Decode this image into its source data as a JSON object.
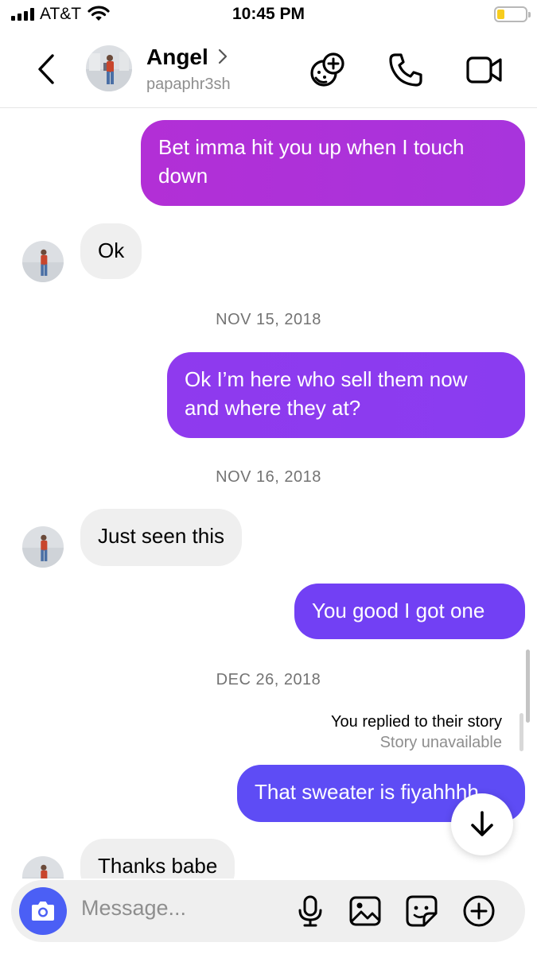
{
  "status": {
    "carrier": "AT&T",
    "time": "10:45 PM",
    "battery_color": "#f7cc1d"
  },
  "header": {
    "name": "Angel",
    "username": "papaphr3sh",
    "icons": [
      "back-icon",
      "chevron-right-icon",
      "add-effects-icon",
      "phone-icon",
      "video-icon"
    ]
  },
  "messages": [
    {
      "type": "out",
      "text": "Bet imma hit you up when I touch down"
    },
    {
      "type": "in",
      "text": "Ok"
    },
    {
      "type": "date",
      "text": "NOV 15, 2018"
    },
    {
      "type": "out",
      "text": "Ok I’m here who sell them now and where they at?"
    },
    {
      "type": "date",
      "text": "NOV 16, 2018"
    },
    {
      "type": "in",
      "text": "Just seen this"
    },
    {
      "type": "out",
      "text": "You good I got one"
    },
    {
      "type": "date",
      "text": "DEC 26, 2018"
    },
    {
      "type": "reply_note",
      "text": "You replied to their story",
      "sub": "Story unavailable"
    },
    {
      "type": "out",
      "text": "That sweater is fiyahhhh"
    },
    {
      "type": "in",
      "text": "Thanks babe"
    }
  ],
  "composer": {
    "placeholder": "Message...",
    "icons": [
      "camera-icon",
      "microphone-icon",
      "gallery-icon",
      "sticker-icon",
      "plus-icon"
    ]
  },
  "colors": {
    "bubble_gradient": [
      "#b22fd6",
      "#8a3cf0",
      "#7240f4",
      "#5e4cf5"
    ],
    "incoming_bubble": "#efefef",
    "camera_button": "#4b5ff5"
  }
}
